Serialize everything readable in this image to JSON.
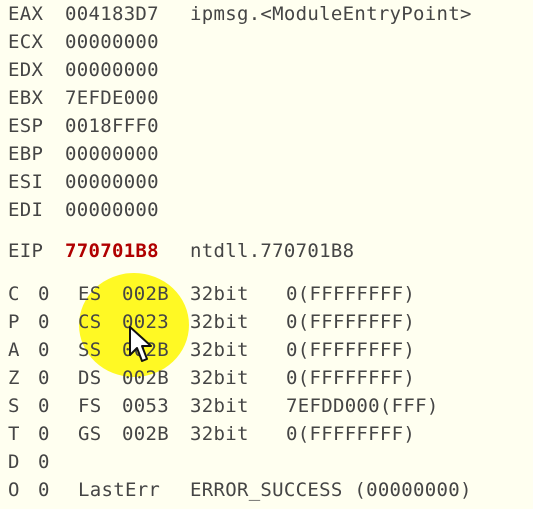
{
  "registers": [
    {
      "name": "EAX",
      "value": "004183D7",
      "symbol": "ipmsg.<ModuleEntryPoint>"
    },
    {
      "name": "ECX",
      "value": "00000000",
      "symbol": ""
    },
    {
      "name": "EDX",
      "value": "00000000",
      "symbol": ""
    },
    {
      "name": "EBX",
      "value": "7EFDE000",
      "symbol": ""
    },
    {
      "name": "ESP",
      "value": "0018FFF0",
      "symbol": ""
    },
    {
      "name": "EBP",
      "value": "00000000",
      "symbol": ""
    },
    {
      "name": "ESI",
      "value": "00000000",
      "symbol": ""
    },
    {
      "name": "EDI",
      "value": "00000000",
      "symbol": ""
    }
  ],
  "eip": {
    "name": "EIP",
    "value": "770701B8",
    "symbol": "ntdll.770701B8"
  },
  "flags": [
    {
      "name": "C",
      "value": "0",
      "seg": {
        "name": "ES",
        "sel": "002B",
        "bits": "32bit",
        "limit": "0(FFFFFFFF)"
      }
    },
    {
      "name": "P",
      "value": "0",
      "seg": {
        "name": "CS",
        "sel": "0023",
        "bits": "32bit",
        "limit": "0(FFFFFFFF)"
      }
    },
    {
      "name": "A",
      "value": "0",
      "seg": {
        "name": "SS",
        "sel": "002B",
        "bits": "32bit",
        "limit": "0(FFFFFFFF)"
      }
    },
    {
      "name": "Z",
      "value": "0",
      "seg": {
        "name": "DS",
        "sel": "002B",
        "bits": "32bit",
        "limit": "0(FFFFFFFF)"
      }
    },
    {
      "name": "S",
      "value": "0",
      "seg": {
        "name": "FS",
        "sel": "0053",
        "bits": "32bit",
        "limit": "7EFDD000(FFF)"
      }
    },
    {
      "name": "T",
      "value": "0",
      "seg": {
        "name": "GS",
        "sel": "002B",
        "bits": "32bit",
        "limit": "0(FFFFFFFF)"
      }
    },
    {
      "name": "D",
      "value": "0"
    },
    {
      "name": "O",
      "value": "0"
    }
  ],
  "lasterr": {
    "label": "LastErr",
    "value": "ERROR_SUCCESS (00000000)"
  },
  "colors": {
    "background": "#fffff0",
    "text": "#454545",
    "changed": "#b00000",
    "cursor_highlight": "#fff800"
  }
}
